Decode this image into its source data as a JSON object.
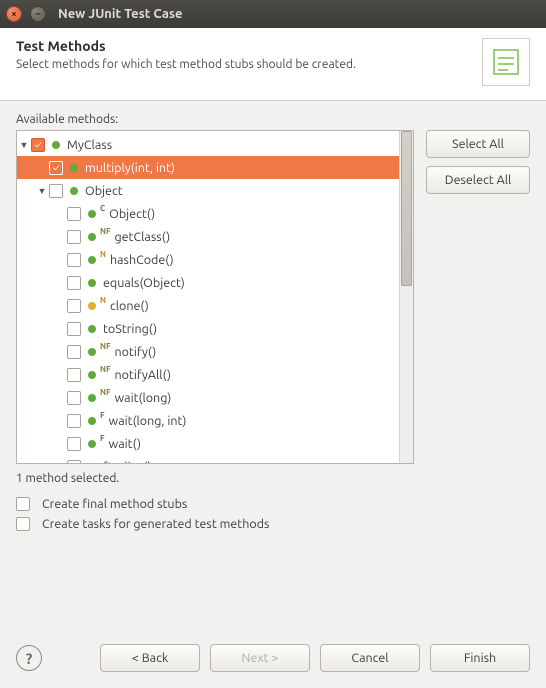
{
  "window": {
    "title": "New JUnit Test Case"
  },
  "header": {
    "title": "Test Methods",
    "subtitle": "Select methods for which test method stubs should be created."
  },
  "labels": {
    "available": "Available methods:",
    "status": "1 method selected."
  },
  "tree": [
    {
      "id": "myclass",
      "indent": 0,
      "arrow": "▼",
      "checked": true,
      "icon": "green",
      "sup": "",
      "label": "MyClass",
      "selected": false
    },
    {
      "id": "multiply",
      "indent": 1,
      "arrow": "",
      "checked": true,
      "icon": "green",
      "sup": "",
      "label": "multiply(int, int)",
      "selected": true
    },
    {
      "id": "object",
      "indent": 1,
      "arrow": "▼",
      "checked": false,
      "icon": "green",
      "sup": "",
      "label": "Object",
      "selected": false
    },
    {
      "id": "object-ctor",
      "indent": 2,
      "arrow": "",
      "checked": false,
      "icon": "green",
      "sup": "C",
      "label": "Object()",
      "selected": false
    },
    {
      "id": "getclass",
      "indent": 2,
      "arrow": "",
      "checked": false,
      "icon": "green",
      "sup": "NF",
      "label": "getClass()",
      "selected": false
    },
    {
      "id": "hashcode",
      "indent": 2,
      "arrow": "",
      "checked": false,
      "icon": "green",
      "sup": "N",
      "label": "hashCode()",
      "selected": false
    },
    {
      "id": "equals",
      "indent": 2,
      "arrow": "",
      "checked": false,
      "icon": "green",
      "sup": "",
      "label": "equals(Object)",
      "selected": false
    },
    {
      "id": "clone",
      "indent": 2,
      "arrow": "",
      "checked": false,
      "icon": "yellow",
      "sup": "N",
      "label": "clone()",
      "selected": false
    },
    {
      "id": "tostring",
      "indent": 2,
      "arrow": "",
      "checked": false,
      "icon": "green",
      "sup": "",
      "label": "toString()",
      "selected": false
    },
    {
      "id": "notify",
      "indent": 2,
      "arrow": "",
      "checked": false,
      "icon": "green",
      "sup": "NF",
      "label": "notify()",
      "selected": false
    },
    {
      "id": "notifyall",
      "indent": 2,
      "arrow": "",
      "checked": false,
      "icon": "green",
      "sup": "NF",
      "label": "notifyAll()",
      "selected": false
    },
    {
      "id": "wait-long",
      "indent": 2,
      "arrow": "",
      "checked": false,
      "icon": "green",
      "sup": "NF",
      "label": "wait(long)",
      "selected": false
    },
    {
      "id": "wait-long-int",
      "indent": 2,
      "arrow": "",
      "checked": false,
      "icon": "green",
      "sup": "F",
      "label": "wait(long, int)",
      "selected": false
    },
    {
      "id": "wait",
      "indent": 2,
      "arrow": "",
      "checked": false,
      "icon": "green",
      "sup": "F",
      "label": "wait()",
      "selected": false
    },
    {
      "id": "finalize",
      "indent": 2,
      "arrow": "",
      "checked": false,
      "icon": "yellow",
      "sup": "",
      "label": "finalize()",
      "selected": false
    }
  ],
  "side": {
    "selectAll": "Select All",
    "deselectAll": "Deselect All"
  },
  "options": {
    "finalStubs": "Create final method stubs",
    "createTasks": "Create tasks for generated test methods"
  },
  "footer": {
    "back": "< Back",
    "next": "Next >",
    "cancel": "Cancel",
    "finish": "Finish"
  }
}
